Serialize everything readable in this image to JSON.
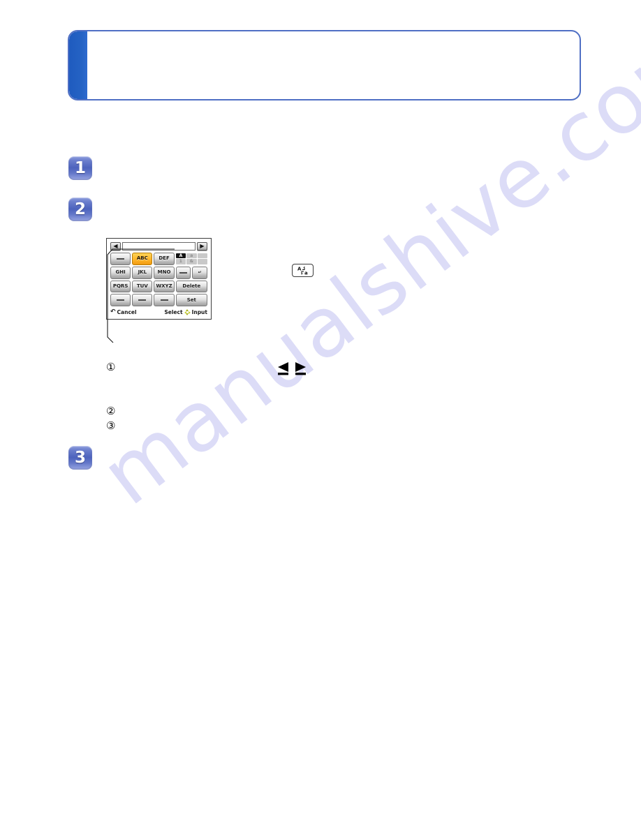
{
  "page": {
    "watermark": "manualshive.com",
    "background_color": "#ffffff",
    "watermark_color": "#dcdcf7"
  },
  "note_box": {
    "accent_color": "#2563c4",
    "border_color": "#4f6fc4",
    "text": ""
  },
  "steps": [
    {
      "number": "1",
      "text": ""
    },
    {
      "number": "2",
      "text": ""
    },
    {
      "number": "3",
      "text": ""
    }
  ],
  "camera_screen": {
    "entry_field_value": "",
    "nav_left_icon": "◀",
    "nav_right_icon": "▶",
    "keys": [
      {
        "label": "",
        "style": "blank",
        "name": "key-blank-1"
      },
      {
        "label": "ABC",
        "style": "highlight",
        "name": "key-abc"
      },
      {
        "label": "DEF",
        "style": "normal",
        "name": "key-def"
      },
      {
        "label": "GHI",
        "style": "normal",
        "name": "key-ghi"
      },
      {
        "label": "JKL",
        "style": "normal",
        "name": "key-jkl"
      },
      {
        "label": "MNO",
        "style": "normal",
        "name": "key-mno"
      },
      {
        "label": "PQRS",
        "style": "normal",
        "name": "key-pqrs"
      },
      {
        "label": "TUV",
        "style": "normal",
        "name": "key-tuv"
      },
      {
        "label": "WXYZ",
        "style": "normal",
        "name": "key-wxyz"
      },
      {
        "label": "",
        "style": "blank",
        "name": "key-blank-2"
      },
      {
        "label": "",
        "style": "blank",
        "name": "key-blank-3"
      },
      {
        "label": "",
        "style": "blank",
        "name": "key-blank-4"
      }
    ],
    "char_mode": {
      "cells": [
        {
          "label": "A",
          "active": true
        },
        {
          "label": "a",
          "active": false
        },
        {
          "label": "",
          "active": false
        },
        {
          "label": "1",
          "active": false
        },
        {
          "label": "&",
          "active": false
        },
        {
          "label": "",
          "active": false
        }
      ]
    },
    "symbol_keys": [
      {
        "label": "",
        "name": "key-space"
      },
      {
        "label": "↵",
        "name": "key-case-switch"
      }
    ],
    "delete_label": "Delete",
    "set_label": "Set",
    "bar": {
      "cancel_label": "Cancel",
      "cancel_icon": "↶",
      "select_label": "Select",
      "input_label": "Input",
      "dpad_icon": "dpad-icon"
    }
  },
  "callout": {
    "label": ""
  },
  "inline_icons": {
    "switch_key": {
      "top_char": "A",
      "bottom_char": "a"
    },
    "left_right_arrows": "◀ ▶"
  },
  "sub_items": [
    {
      "marker": "①",
      "text": ""
    },
    {
      "marker": "②",
      "text": ""
    },
    {
      "marker": "③",
      "text": ""
    }
  ]
}
